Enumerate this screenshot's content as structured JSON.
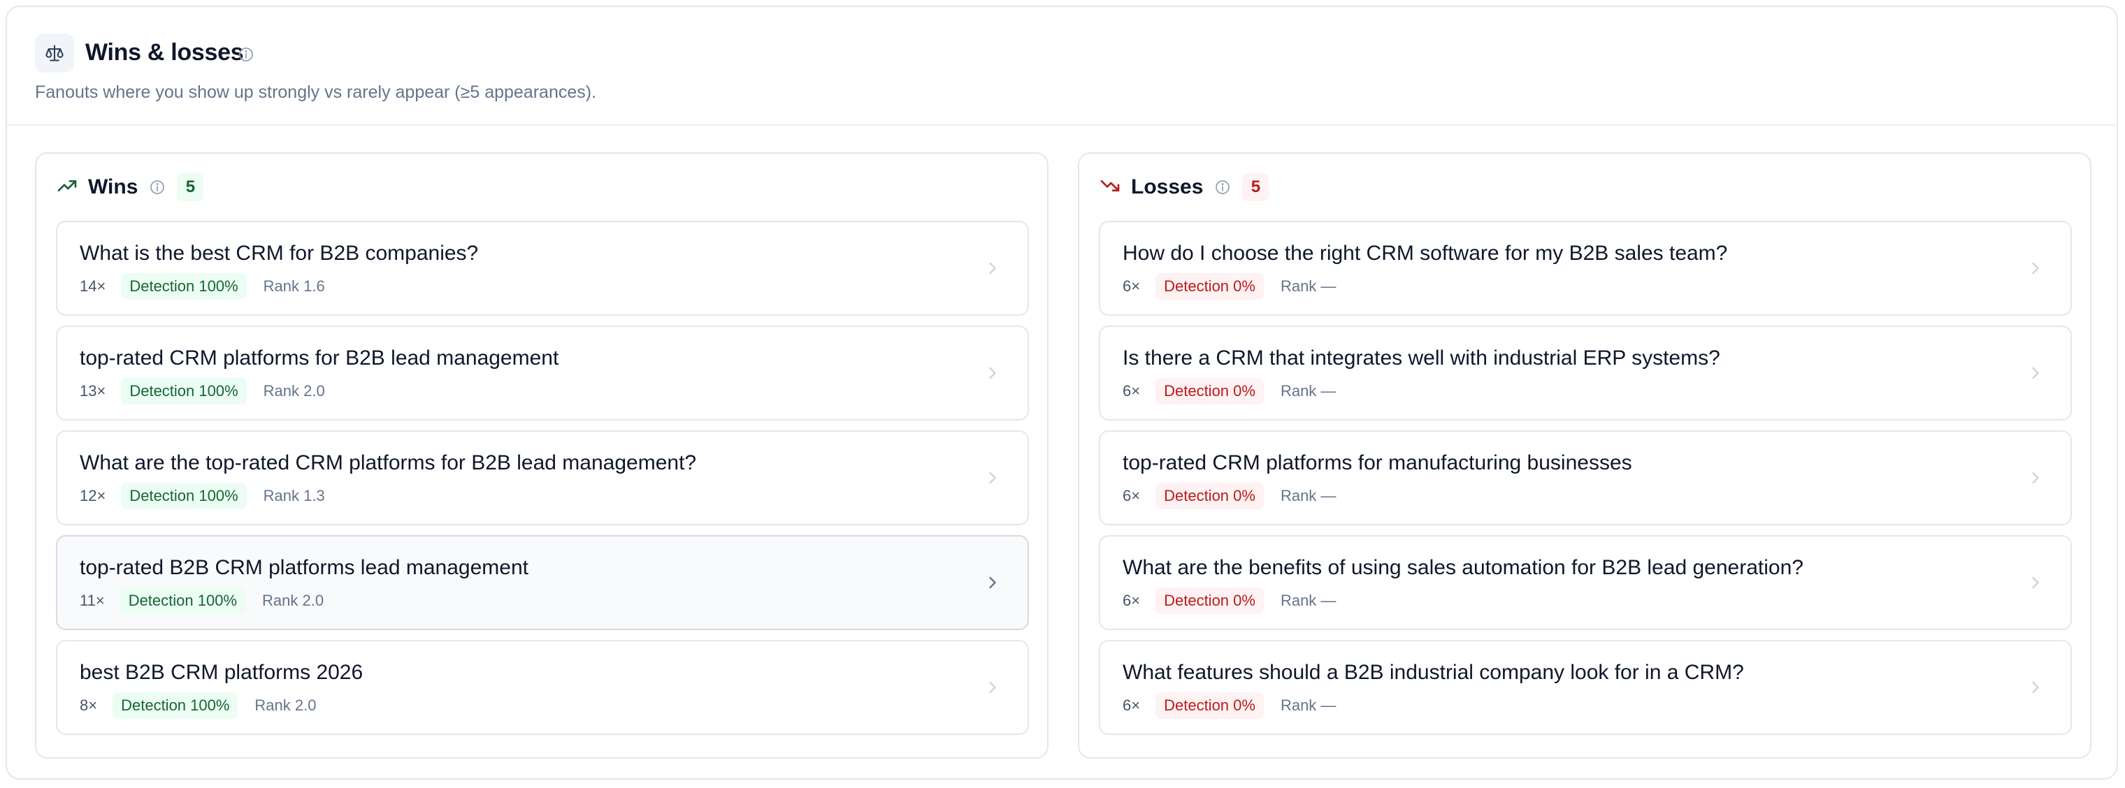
{
  "header": {
    "icon": "scale-icon",
    "title": "Wins & losses",
    "subtitle": "Fanouts where you show up strongly vs rarely appear (≥5 appearances)."
  },
  "wins": {
    "title": "Wins",
    "count": "5",
    "icon": "trending-up-icon",
    "accent": "#166534",
    "items": [
      {
        "question": "What is the best CRM for B2B companies?",
        "count": "14×",
        "detection": "Detection 100%",
        "rank": "Rank 1.6"
      },
      {
        "question": "top-rated CRM platforms for B2B lead management",
        "count": "13×",
        "detection": "Detection 100%",
        "rank": "Rank 2.0"
      },
      {
        "question": "What are the top-rated CRM platforms for B2B lead management?",
        "count": "12×",
        "detection": "Detection 100%",
        "rank": "Rank 1.3"
      },
      {
        "question": "top-rated B2B CRM platforms lead management",
        "count": "11×",
        "detection": "Detection 100%",
        "rank": "Rank 2.0"
      },
      {
        "question": "best B2B CRM platforms 2026",
        "count": "8×",
        "detection": "Detection 100%",
        "rank": "Rank 2.0"
      }
    ]
  },
  "losses": {
    "title": "Losses",
    "count": "5",
    "icon": "trending-down-icon",
    "accent": "#b91c1c",
    "items": [
      {
        "question": "How do I choose the right CRM software for my B2B sales team?",
        "count": "6×",
        "detection": "Detection 0%",
        "rank": "Rank —"
      },
      {
        "question": "Is there a CRM that integrates well with industrial ERP systems?",
        "count": "6×",
        "detection": "Detection 0%",
        "rank": "Rank —"
      },
      {
        "question": "top-rated CRM platforms for manufacturing businesses",
        "count": "6×",
        "detection": "Detection 0%",
        "rank": "Rank —"
      },
      {
        "question": "What are the benefits of using sales automation for B2B lead generation?",
        "count": "6×",
        "detection": "Detection 0%",
        "rank": "Rank —"
      },
      {
        "question": "What features should a B2B industrial company look for in a CRM?",
        "count": "6×",
        "detection": "Detection 0%",
        "rank": "Rank —"
      }
    ]
  }
}
